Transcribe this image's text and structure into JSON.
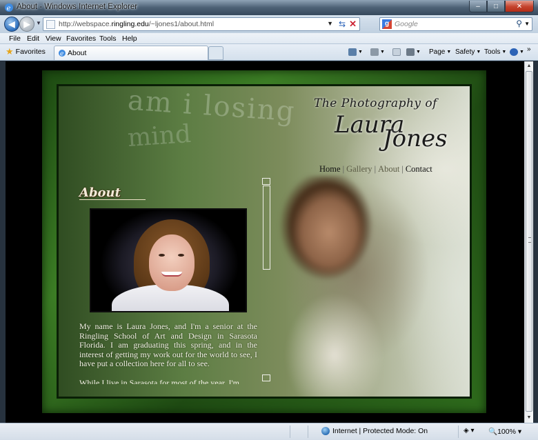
{
  "window": {
    "title": "About - Windows Internet Explorer",
    "minimize_glyph": "–",
    "maximize_glyph": "□",
    "close_glyph": "✕"
  },
  "address_bar": {
    "url_prefix": "http://webspace.",
    "url_domain": "ringling.edu",
    "url_suffix": "/~ljones1/about.html",
    "search_placeholder": "Google"
  },
  "menu": {
    "items": [
      "File",
      "Edit",
      "View",
      "Favorites",
      "Tools",
      "Help"
    ]
  },
  "favorites_bar": {
    "favorites_label": "Favorites",
    "tab_label": "About",
    "commands": [
      "Page",
      "Safety",
      "Tools"
    ]
  },
  "site": {
    "title_line1": "The Photography of",
    "title_name_first": "Laura",
    "title_name_last": "Jones",
    "nav": [
      "Home",
      "Gallery",
      "About",
      "Contact"
    ],
    "nav_separator": "|",
    "about_heading": "About",
    "background_text_1": "am i losing",
    "background_text_2": "mind",
    "bio_paragraph": "My name is Laura Jones, and I'm a senior at the Ringling School of Art and Design in Sarasota Florida. I am graduating this spring, and in the interest of getting my work out for the world to see, I have put a collection here for all to see.",
    "bio_cut_line": "While I live in Sarasota for most of the year, I'm"
  },
  "status_bar": {
    "zone_text": "Internet | Protected Mode: On",
    "zoom_text": "100%"
  },
  "colors": {
    "frame_green": "#3c7d25",
    "text_cream": "#f4f1e6"
  }
}
